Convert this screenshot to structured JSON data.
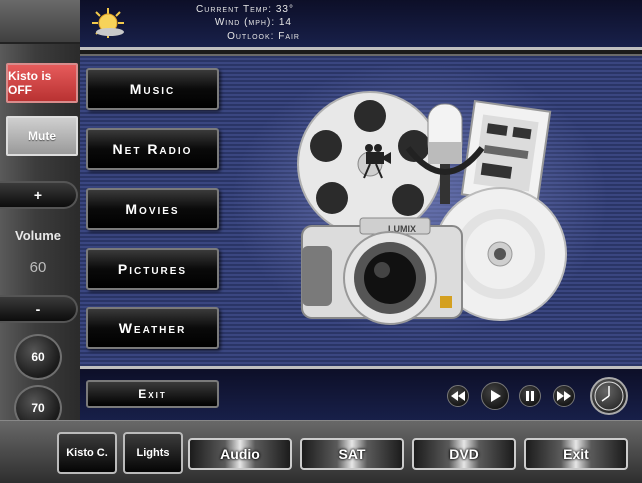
{
  "weather": {
    "current_temp": "Current Temp: 33°",
    "wind": "Wind (mph): 14",
    "outlook": "Outlook: Fair"
  },
  "left_panel": {
    "kisto_status": "Kisto is OFF",
    "mute": "Mute",
    "volume_plus": "+",
    "volume_label": "Volume",
    "volume_value": "60",
    "volume_minus": "-",
    "presets": [
      "60",
      "70"
    ]
  },
  "menu": {
    "music": "Music",
    "net_radio": "Net Radio",
    "movies": "Movies",
    "pictures": "Pictures",
    "weather": "Weather",
    "exit": "Exit"
  },
  "bottom_nav": {
    "kisto": "Kisto C.",
    "lights": "Lights",
    "audio": "Audio",
    "sat": "SAT",
    "dvd": "DVD",
    "exit": "Exit"
  },
  "collage": {
    "camera_brand": "LUMIX"
  },
  "colors": {
    "status_off": "#c84040",
    "content_stripe_a": "#2a3566",
    "content_stripe_b": "#3a4680",
    "header_bg": "#0d0f28"
  },
  "icons": [
    "sun-icon",
    "rewind-icon",
    "play-icon",
    "pause-icon",
    "fast-forward-icon",
    "clock-icon"
  ]
}
